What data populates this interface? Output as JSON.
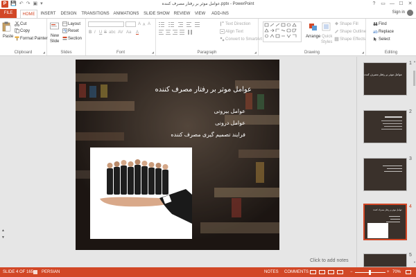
{
  "window": {
    "title": "عوامل موثر بر رفتار مصرف کننده.pptx - PowerPoint",
    "app_icon_letter": "P",
    "help": "?",
    "restore": "▭",
    "minimize": "—",
    "maximize": "☐",
    "close": "✕"
  },
  "qat": {
    "save": "💾",
    "undo": "↶",
    "redo": "↷",
    "start": "▣",
    "more": "▾"
  },
  "tabs": [
    "FILE",
    "HOME",
    "INSERT",
    "DESIGN",
    "TRANSITIONS",
    "ANIMATIONS",
    "SLIDE SHOW",
    "REVIEW",
    "VIEW",
    "ADD-INS"
  ],
  "account": {
    "signin": "Sign in"
  },
  "ribbon": {
    "clipboard": {
      "label": "Clipboard",
      "paste": "Paste",
      "cut": "Cut",
      "copy": "Copy",
      "format_painter": "Format Painter"
    },
    "slides": {
      "label": "Slides",
      "new_slide": "New",
      "new_slide2": "Slide",
      "layout": "Layout",
      "reset": "Reset",
      "section": "Section"
    },
    "font": {
      "label": "Font",
      "bold": "B",
      "italic": "I",
      "underline": "U",
      "strike": "S",
      "shadow": "abc",
      "spacing": "AV",
      "case": "Aa",
      "grow": "A",
      "shrink": "A",
      "clear": "A",
      "color": "A"
    },
    "paragraph": {
      "label": "Paragraph",
      "text_direction": "Text Direction",
      "align_text": "Align Text",
      "convert_smartart": "Convert to SmartArt"
    },
    "drawing": {
      "label": "Drawing",
      "arrange": "Arrange",
      "quick_styles": "Quick",
      "quick_styles2": "Styles",
      "shape_fill": "Shape Fill",
      "shape_outline": "Shape Outline",
      "shape_effects": "Shape Effects"
    },
    "editing": {
      "label": "Editing",
      "find": "Find",
      "replace": "Replace",
      "select": "Select"
    }
  },
  "slide": {
    "title": "عوامل موثر بر رفتار مصرف کننده",
    "bullets": [
      "عوامل بیرونی",
      "عوامل درونی",
      "فرایند تصمیم گیری مصرف کننده"
    ]
  },
  "thumbnails": [
    {
      "num": "1",
      "title": "عوامل موثر بر رفتار مصرف کننده"
    },
    {
      "num": "2"
    },
    {
      "num": "3"
    },
    {
      "num": "4",
      "title": "عوامل موثر بر رفتار مصرف کننده"
    },
    {
      "num": "5"
    }
  ],
  "notes": {
    "placeholder": "Click to add notes"
  },
  "status": {
    "slide_indicator": "SLIDE 4 OF 165",
    "language": "PERSIAN",
    "notes": "NOTES",
    "comments": "COMMENTS",
    "zoom": "70%"
  },
  "colors": {
    "accent": "#d24726",
    "ribbon_bg": "#ffffff",
    "workspace": "#e6e6e6",
    "slide_bg": "#38302c"
  },
  "icons": {
    "app": "powerpoint-icon",
    "save": "save-icon",
    "undo": "undo-icon",
    "redo": "redo-icon",
    "paste": "clipboard-icon",
    "cut": "scissors-icon",
    "copy": "copy-icon",
    "painter": "paintbrush-icon",
    "new_slide": "new-slide-icon",
    "layout": "layout-icon",
    "reset": "reset-icon",
    "section": "section-icon",
    "find": "binoculars-icon",
    "replace": "replace-icon",
    "select": "cursor-icon"
  }
}
